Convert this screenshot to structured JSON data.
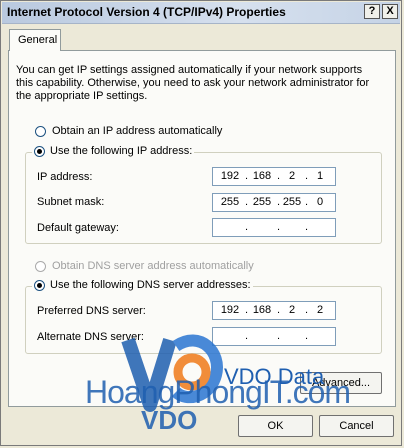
{
  "window": {
    "title": "Internet Protocol Version 4 (TCP/IPv4) Properties",
    "help_label": "?",
    "close_label": "X"
  },
  "tabs": [
    {
      "label": "General"
    }
  ],
  "description": "You can get IP settings assigned automatically if your network supports this capability. Otherwise, you need to ask your network administrator for the appropriate IP settings.",
  "ip": {
    "auto_option": "Obtain an IP address automatically",
    "manual_option": "Use the following IP address:",
    "ip_label": "IP address:",
    "ip_value": [
      "192",
      "168",
      "2",
      "1"
    ],
    "mask_label": "Subnet mask:",
    "mask_value": [
      "255",
      "255",
      "255",
      "0"
    ],
    "gateway_label": "Default gateway:",
    "gateway_value": [
      "",
      "",
      "",
      ""
    ]
  },
  "dns": {
    "auto_option": "Obtain DNS server address automatically",
    "manual_option": "Use the following DNS server addresses:",
    "preferred_label": "Preferred DNS server:",
    "preferred_value": [
      "192",
      "168",
      "2",
      "2"
    ],
    "alternate_label": "Alternate DNS server:",
    "alternate_value": [
      "",
      "",
      "",
      ""
    ]
  },
  "buttons": {
    "advanced": "Advanced...",
    "ok": "OK",
    "cancel": "Cancel"
  },
  "watermark": {
    "brand": "VDO Data",
    "site": "HoangPhongIT.com",
    "logo_text": "VDO",
    "color": "#1f5fb0"
  }
}
